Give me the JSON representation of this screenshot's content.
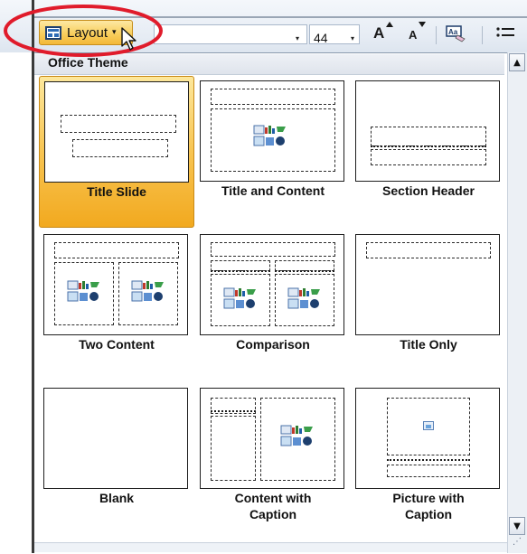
{
  "ribbon": {
    "layout_button_label": "Layout",
    "layout_button_arrow": "▾",
    "font_name_value": "",
    "font_size_value": "44",
    "grow_font_glyph": "A",
    "shrink_font_glyph": "A",
    "dropdown_arrow": "▾"
  },
  "gallery": {
    "section_title": "Office Theme",
    "layouts": [
      {
        "label": "Title Slide",
        "selected": true
      },
      {
        "label": "Title and Content",
        "selected": false
      },
      {
        "label": "Section Header",
        "selected": false
      },
      {
        "label": "Two Content",
        "selected": false
      },
      {
        "label": "Comparison",
        "selected": false
      },
      {
        "label": "Title Only",
        "selected": false
      },
      {
        "label": "Blank",
        "selected": false
      },
      {
        "label": "Content with Caption",
        "selected": false
      },
      {
        "label": "Picture with Caption",
        "selected": false
      }
    ]
  },
  "scrollbar": {
    "up_arrow": "▲",
    "down_arrow": "▼",
    "resize_grip": "⋰"
  },
  "colors": {
    "selected_fill": "#f8c552",
    "highlight_ellipse": "#e01b2b",
    "accent_blue": "#2e6bb5"
  },
  "icons": [
    "layout-icon",
    "grow-font-icon",
    "shrink-font-icon",
    "clear-formatting-icon",
    "bullets-icon",
    "content-placeholder-icon",
    "picture-placeholder-icon",
    "mouse-cursor-icon"
  ]
}
